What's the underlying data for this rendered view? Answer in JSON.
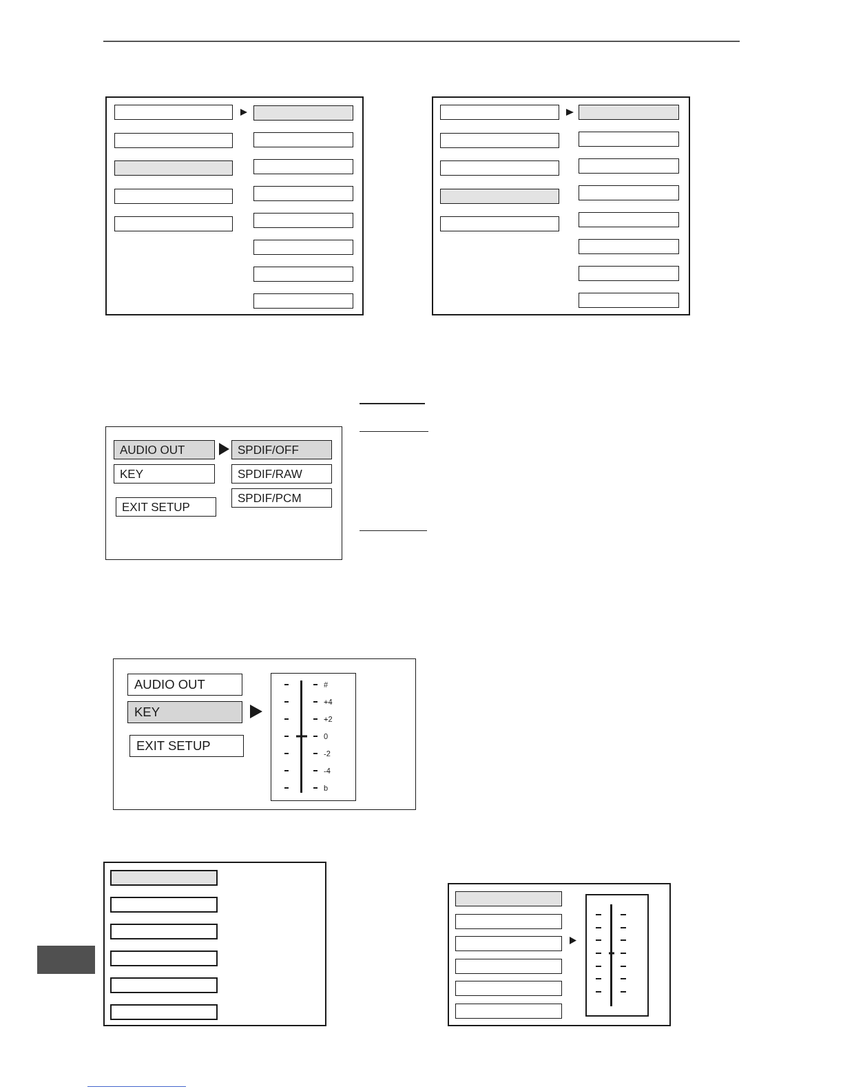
{
  "figures": [
    {
      "kind": "menu",
      "left": [
        {
          "selected": false
        },
        {
          "selected": false
        },
        {
          "selected": true
        },
        {
          "selected": false
        },
        {
          "selected": false
        }
      ],
      "right": [
        {
          "selected": true
        },
        {
          "selected": false
        },
        {
          "selected": false
        },
        {
          "selected": false
        },
        {
          "selected": false
        },
        {
          "selected": false
        },
        {
          "selected": false
        },
        {
          "selected": false
        }
      ]
    },
    {
      "kind": "menu",
      "left": [
        {
          "selected": false
        },
        {
          "selected": false
        },
        {
          "selected": false
        },
        {
          "selected": true
        },
        {
          "selected": false
        }
      ],
      "right": [
        {
          "selected": true
        },
        {
          "selected": false
        },
        {
          "selected": false
        },
        {
          "selected": false
        },
        {
          "selected": false
        },
        {
          "selected": false
        },
        {
          "selected": false
        },
        {
          "selected": false
        }
      ]
    },
    {
      "kind": "menu",
      "left": [
        {
          "label": "AUDIO OUT",
          "selected": true
        },
        {
          "label": "KEY",
          "selected": false
        },
        {
          "label": "EXIT SETUP",
          "selected": false
        }
      ],
      "right": [
        {
          "label": "SPDIF/OFF",
          "selected": true
        },
        {
          "label": "SPDIF/RAW",
          "selected": false
        },
        {
          "label": "SPDIF/PCM",
          "selected": false
        }
      ]
    },
    {
      "kind": "slider",
      "left": [
        {
          "label": "AUDIO OUT",
          "selected": false
        },
        {
          "label": "KEY",
          "selected": true
        },
        {
          "label": "EXIT SETUP",
          "selected": false
        }
      ],
      "slider": {
        "level": 0.5,
        "scale": [
          "#",
          "+4",
          "+2",
          "0",
          "-2",
          "-4",
          "b"
        ]
      }
    },
    {
      "kind": "list",
      "left": [
        {
          "selected": true
        },
        {
          "selected": false
        },
        {
          "selected": false
        },
        {
          "selected": false
        },
        {
          "selected": false
        },
        {
          "selected": false
        }
      ]
    },
    {
      "kind": "slider",
      "left": [
        {
          "selected": true
        },
        {
          "selected": false
        },
        {
          "selected": false
        },
        {
          "selected": false
        },
        {
          "selected": false
        },
        {
          "selected": false
        }
      ],
      "slider": {
        "level": 0.5
      }
    }
  ]
}
